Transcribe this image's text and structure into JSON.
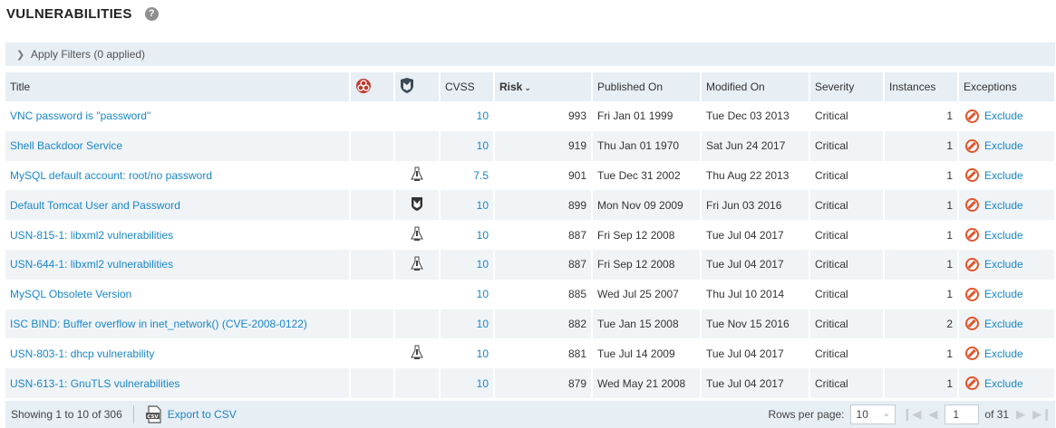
{
  "header": {
    "title": "VULNERABILITIES",
    "help_icon": "question-circle-icon"
  },
  "filters": {
    "label": "Apply Filters (0 applied)"
  },
  "table": {
    "columns": {
      "title": "Title",
      "malware": "",
      "exploit": "",
      "cvss": "CVSS",
      "risk": "Risk",
      "published": "Published On",
      "modified": "Modified On",
      "severity": "Severity",
      "instances": "Instances",
      "exceptions": "Exceptions"
    },
    "rows": [
      {
        "title": "VNC password is \"password\"",
        "exploit": "",
        "cvss": "10",
        "risk": "993",
        "published": "Fri Jan 01 1999",
        "modified": "Tue Dec 03 2013",
        "severity": "Critical",
        "instances": "1",
        "exception": "Exclude"
      },
      {
        "title": "Shell Backdoor Service",
        "exploit": "",
        "cvss": "10",
        "risk": "919",
        "published": "Thu Jan 01 1970",
        "modified": "Sat Jun 24 2017",
        "severity": "Critical",
        "instances": "1",
        "exception": "Exclude"
      },
      {
        "title": "MySQL default account: root/no password",
        "exploit": "skill-icon",
        "cvss": "7.5",
        "risk": "901",
        "published": "Tue Dec 31 2002",
        "modified": "Thu Aug 22 2013",
        "severity": "Critical",
        "instances": "1",
        "exception": "Exclude"
      },
      {
        "title": "Default Tomcat User and Password",
        "exploit": "metasploit-icon",
        "cvss": "10",
        "risk": "899",
        "published": "Mon Nov 09 2009",
        "modified": "Fri Jun 03 2016",
        "severity": "Critical",
        "instances": "1",
        "exception": "Exclude"
      },
      {
        "title": "USN-815-1: libxml2 vulnerabilities",
        "exploit": "skill-icon",
        "cvss": "10",
        "risk": "887",
        "published": "Fri Sep 12 2008",
        "modified": "Tue Jul 04 2017",
        "severity": "Critical",
        "instances": "1",
        "exception": "Exclude"
      },
      {
        "title": "USN-644-1: libxml2 vulnerabilities",
        "exploit": "skill-icon",
        "cvss": "10",
        "risk": "887",
        "published": "Fri Sep 12 2008",
        "modified": "Tue Jul 04 2017",
        "severity": "Critical",
        "instances": "1",
        "exception": "Exclude"
      },
      {
        "title": "MySQL Obsolete Version",
        "exploit": "",
        "cvss": "10",
        "risk": "885",
        "published": "Wed Jul 25 2007",
        "modified": "Thu Jul 10 2014",
        "severity": "Critical",
        "instances": "1",
        "exception": "Exclude"
      },
      {
        "title": "ISC BIND: Buffer overflow in inet_network() (CVE-2008-0122)",
        "exploit": "",
        "cvss": "10",
        "risk": "882",
        "published": "Tue Jan 15 2008",
        "modified": "Tue Nov 15 2016",
        "severity": "Critical",
        "instances": "2",
        "exception": "Exclude"
      },
      {
        "title": "USN-803-1: dhcp vulnerability",
        "exploit": "skill-icon",
        "cvss": "10",
        "risk": "881",
        "published": "Tue Jul 14 2009",
        "modified": "Tue Jul 04 2017",
        "severity": "Critical",
        "instances": "1",
        "exception": "Exclude"
      },
      {
        "title": "USN-613-1: GnuTLS vulnerabilities",
        "exploit": "",
        "cvss": "10",
        "risk": "879",
        "published": "Wed May 21 2008",
        "modified": "Tue Jul 04 2017",
        "severity": "Critical",
        "instances": "1",
        "exception": "Exclude"
      }
    ]
  },
  "footer": {
    "showing": "Showing 1 to 10 of 306",
    "export_label": "Export to CSV",
    "rows_per_page_label": "Rows per page:",
    "rows_per_page": "10",
    "page": "1",
    "of_pages": "of 31"
  },
  "colors": {
    "link": "#1a86c8",
    "header_bg": "#e7eef4",
    "exclude_icon": "#e0562b",
    "malware_icon": "#c0392b"
  }
}
